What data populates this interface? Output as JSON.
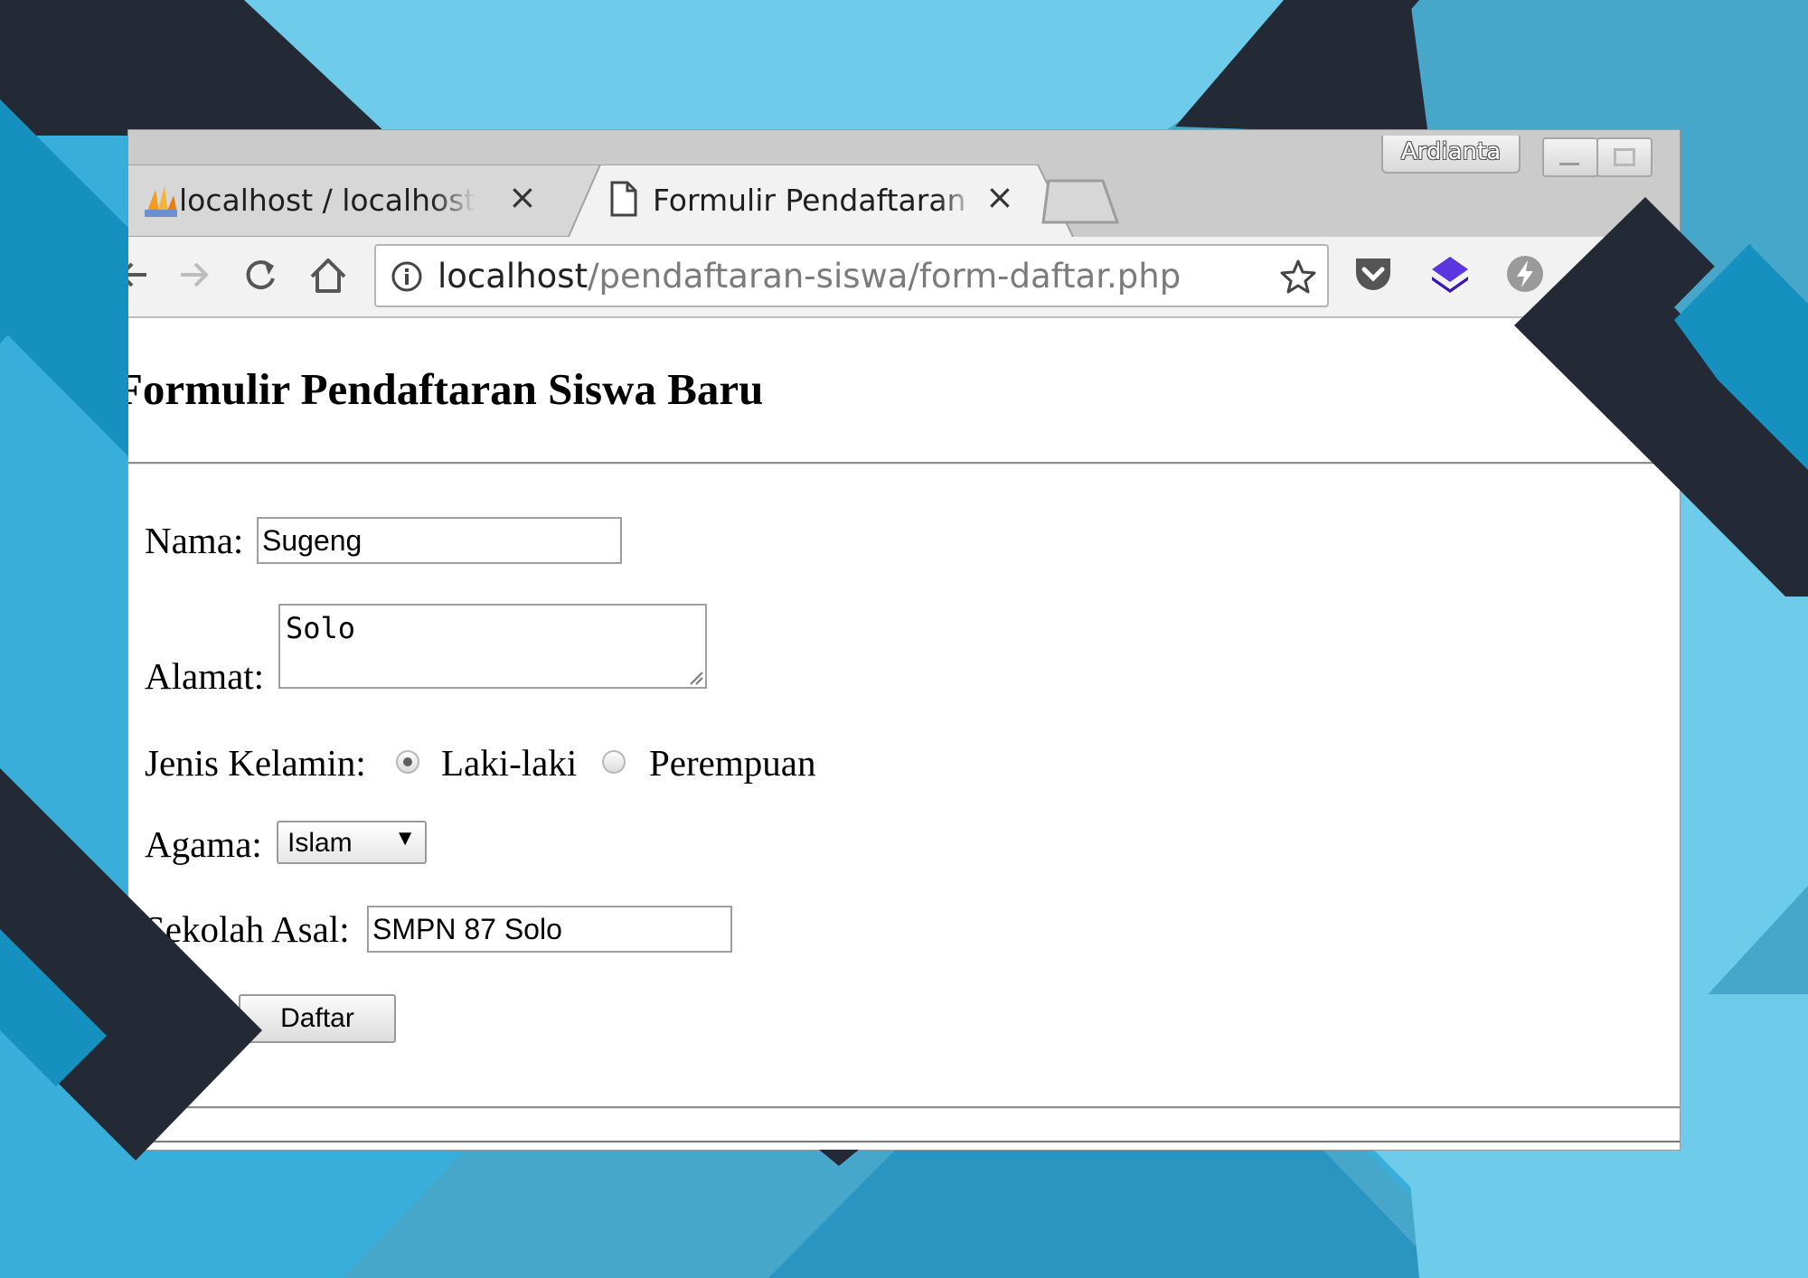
{
  "colors": {
    "background": "#6ecbea",
    "dark_shape": "#232a36",
    "mid_blue": "#47a7cb",
    "deep_blue": "#1590bf",
    "extension_purple": "#4a1fc8"
  },
  "browser": {
    "tabs": [
      {
        "label": "localhost / localhost / pendaftaran",
        "icon": "phpmyadmin-icon",
        "active": false
      },
      {
        "label": "Formulir Pendaftaran Siswa",
        "icon": "page-icon",
        "active": true
      }
    ],
    "profile_name": "Ardianta",
    "url_host": "localhost",
    "url_path": "/pendaftaran-siswa/form-daftar.php",
    "extensions": [
      "pocket-icon",
      "layers-extension-icon",
      "bolt-extension-icon"
    ]
  },
  "page": {
    "title": "Formulir Pendaftaran Siswa Baru",
    "form": {
      "nama_label": "Nama:",
      "nama_value": "Sugeng",
      "alamat_label": "Alamat:",
      "alamat_value": "Solo",
      "jenis_kelamin_label": "Jenis Kelamin:",
      "gender_options": [
        "Laki-laki",
        "Perempuan"
      ],
      "gender_selected": "Laki-laki",
      "agama_label": "Agama:",
      "agama_value": "Islam",
      "sekolah_asal_label": "Sekolah Asal:",
      "sekolah_asal_value": "SMPN 87 Solo",
      "submit_label": "Daftar"
    }
  }
}
